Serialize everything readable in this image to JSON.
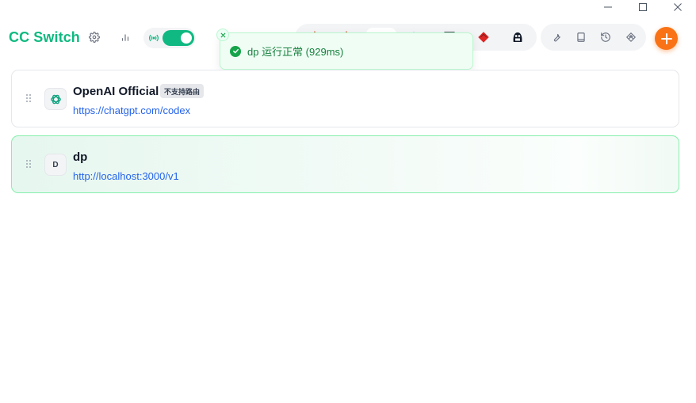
{
  "app": {
    "title": "CC Switch",
    "brand_color": "#10b981"
  },
  "window_controls": [
    {
      "name": "minimize",
      "icon": "minus-icon"
    },
    {
      "name": "maximize",
      "icon": "square-icon"
    },
    {
      "name": "close",
      "icon": "close-icon"
    }
  ],
  "header": {
    "settings_icon": "gear-icon",
    "usage_icon": "bar-chart-icon",
    "proxy": {
      "icon": "signal-icon",
      "enabled": true
    }
  },
  "app_switcher": {
    "apps": [
      {
        "name": "claude",
        "icon": "claude-icon",
        "color": "#d97757"
      },
      {
        "name": "codex",
        "icon": "codex-icon",
        "color": "#111827",
        "active": true
      },
      {
        "name": "gemini",
        "icon": "gemini-icon",
        "color": "#4f8df5"
      },
      {
        "name": "opencode",
        "icon": "terminal-square-icon",
        "color": "#111827"
      },
      {
        "name": "app-red",
        "icon": "red-diamond-icon",
        "color": "#dc2626"
      },
      {
        "name": "app-mascot",
        "icon": "mascot-icon",
        "color": "#111827"
      }
    ]
  },
  "tools": [
    {
      "name": "wrench",
      "icon": "wrench-icon"
    },
    {
      "name": "book",
      "icon": "book-icon"
    },
    {
      "name": "history",
      "icon": "history-icon"
    },
    {
      "name": "layers",
      "icon": "layers-icon"
    }
  ],
  "add_button": {
    "icon": "plus-icon",
    "color": "#f97316"
  },
  "toast": {
    "message": "dp 运行正常 (929ms)",
    "status": "success",
    "color": "#16a34a"
  },
  "providers": [
    {
      "name": "OpenAI Official",
      "badge": "不支持路由",
      "url": "https://chatgpt.com/codex",
      "avatar_icon": "openai-icon",
      "avatar_text": "",
      "active": false
    },
    {
      "name": "dp",
      "badge": "",
      "url": "http://localhost:3000/v1",
      "avatar_icon": "",
      "avatar_text": "D",
      "active": true
    }
  ]
}
